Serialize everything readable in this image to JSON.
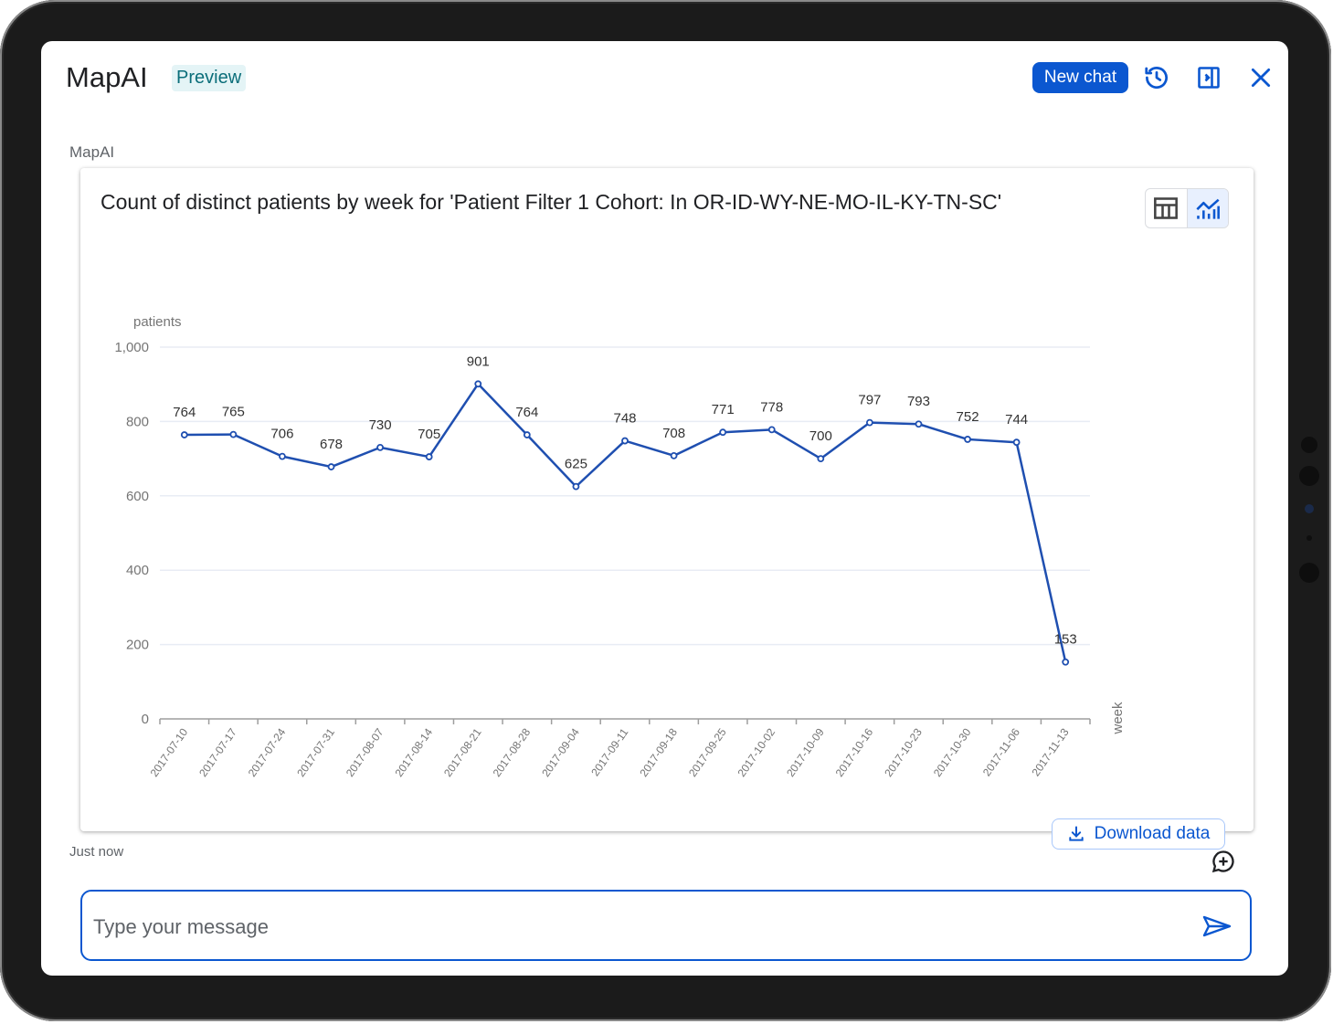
{
  "header": {
    "title": "MapAI",
    "badge": "Preview",
    "new_chat_label": "New chat",
    "icons": [
      "history-icon",
      "side-panel-icon",
      "close-icon"
    ]
  },
  "message": {
    "sender": "MapAI",
    "timestamp": "Just now",
    "card_title": "Count of distinct patients by week for 'Patient Filter 1 Cohort: In OR-ID-WY-NE-MO-IL-KY-TN-SC'",
    "view_toggle": {
      "options": [
        "table",
        "chart"
      ],
      "selected": "chart"
    },
    "download_label": "Download data"
  },
  "composer": {
    "placeholder": "Type your message",
    "value": ""
  },
  "colors": {
    "accent": "#0b57d0",
    "line": "#1f4fb0",
    "grid": "#e8ecf4",
    "badge_bg": "#e4f4f6",
    "badge_text": "#0b6e7a"
  },
  "chart_data": {
    "type": "line",
    "title": "Count of distinct patients by week for 'Patient Filter 1 Cohort: In OR-ID-WY-NE-MO-IL-KY-TN-SC'",
    "xlabel": "week",
    "ylabel": "patients",
    "ylim": [
      0,
      1000
    ],
    "yticks": [
      0,
      200,
      400,
      600,
      800,
      1000
    ],
    "ytick_labels": [
      "0",
      "200",
      "400",
      "600",
      "800",
      "1,000"
    ],
    "grid": true,
    "legend": "none",
    "categories": [
      "2017-07-10",
      "2017-07-17",
      "2017-07-24",
      "2017-07-31",
      "2017-08-07",
      "2017-08-14",
      "2017-08-21",
      "2017-08-28",
      "2017-09-04",
      "2017-09-11",
      "2017-09-18",
      "2017-09-25",
      "2017-10-02",
      "2017-10-09",
      "2017-10-16",
      "2017-10-23",
      "2017-10-30",
      "2017-11-06",
      "2017-11-13"
    ],
    "series": [
      {
        "name": "patients",
        "values": [
          764,
          765,
          706,
          678,
          730,
          705,
          901,
          764,
          625,
          748,
          708,
          771,
          778,
          700,
          797,
          793,
          752,
          744,
          153
        ]
      }
    ]
  }
}
